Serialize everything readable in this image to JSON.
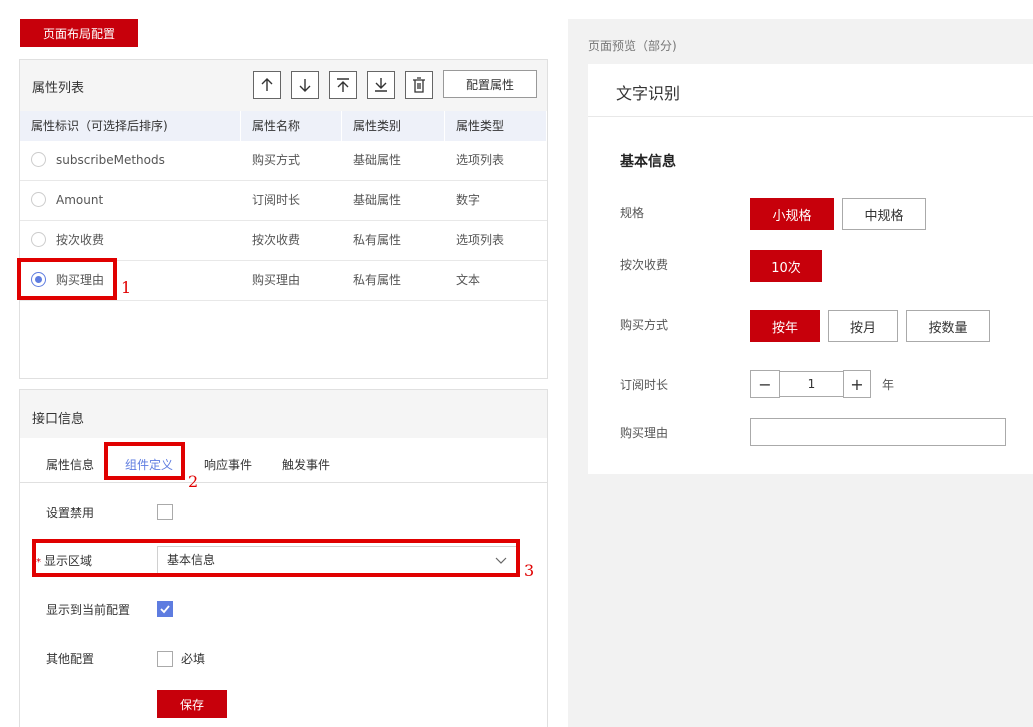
{
  "toolbar": {
    "layout_config_label": "页面布局配置"
  },
  "attr_list": {
    "title": "属性列表",
    "config_button": "配置属性",
    "columns": [
      "属性标识（可选择后排序)",
      "属性名称",
      "属性类别",
      "属性类型"
    ],
    "rows": [
      {
        "id": "subscribeMethods",
        "name": "购买方式",
        "category": "基础属性",
        "type": "选项列表",
        "selected": false
      },
      {
        "id": "Amount",
        "name": "订阅时长",
        "category": "基础属性",
        "type": "数字",
        "selected": false
      },
      {
        "id": "按次收费",
        "name": "按次收费",
        "category": "私有属性",
        "type": "选项列表",
        "selected": false
      },
      {
        "id": "购买理由",
        "name": "购买理由",
        "category": "私有属性",
        "type": "文本",
        "selected": true
      }
    ]
  },
  "interface": {
    "title": "接口信息",
    "tabs": [
      "属性信息",
      "组件定义",
      "响应事件",
      "触发事件"
    ],
    "active_tab": "组件定义",
    "disable_label": "设置禁用",
    "area_label": "显示区域",
    "area_value": "基本信息",
    "show_current_label": "显示到当前配置",
    "other_label": "其他配置",
    "required_label": "必填",
    "save_label": "保存"
  },
  "annotations": [
    "1",
    "2",
    "3"
  ],
  "preview": {
    "label": "页面预览（部分)",
    "title": "文字识别",
    "section": "基本信息",
    "spec_label": "规格",
    "spec_options": [
      "小规格",
      "中规格"
    ],
    "per_use_label": "按次收费",
    "per_use_options": [
      "10次"
    ],
    "buy_method_label": "购买方式",
    "buy_method_options": [
      "按年",
      "按月",
      "按数量"
    ],
    "duration_label": "订阅时长",
    "duration_value": "1",
    "duration_unit": "年",
    "reason_label": "购买理由",
    "minus": "−",
    "plus": "+"
  },
  "colors": {
    "brand_red": "#c7000b",
    "accent_blue": "#5e7ce0"
  }
}
